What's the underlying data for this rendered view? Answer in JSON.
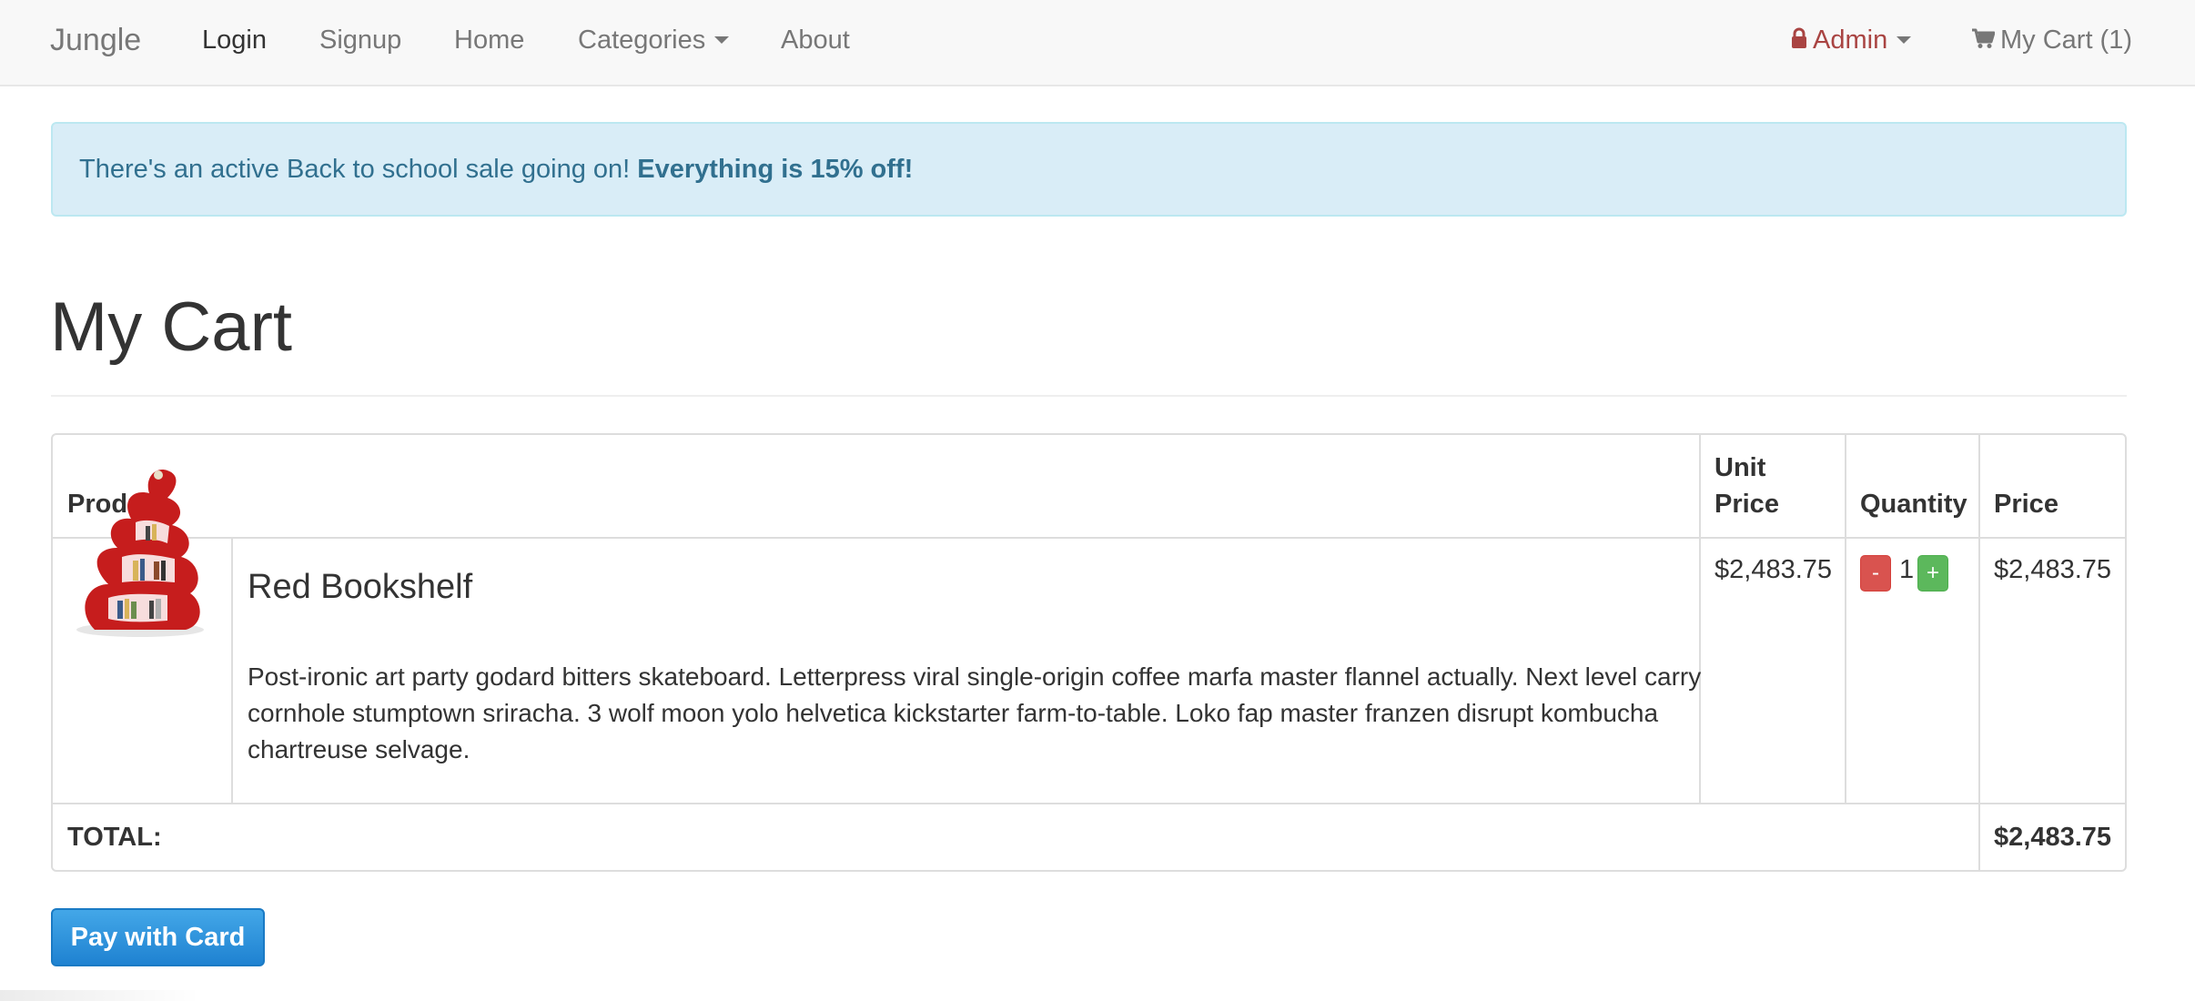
{
  "navbar": {
    "brand": "Jungle",
    "login": "Login",
    "signup": "Signup",
    "home": "Home",
    "categories": "Categories",
    "about": "About",
    "admin": "Admin",
    "cart": "My Cart (1)"
  },
  "alert": {
    "text": "There's an active Back to school sale going on! ",
    "emphasis": "Everything is 15% off!"
  },
  "page": {
    "title": "My Cart"
  },
  "table": {
    "headers": {
      "product": "Product",
      "unit_price_line1": "Unit",
      "unit_price_line2": "Price",
      "quantity": "Quantity",
      "price": "Price"
    },
    "rows": [
      {
        "name": "Red Bookshelf",
        "description": "Post-ironic art party godard bitters skateboard. Letterpress viral single-origin coffee marfa master flannel actually. Next level carry cornhole stumptown sriracha. 3 wolf moon yolo helvetica kickstarter farm-to-table. Loko fap master franzen disrupt kombucha chartreuse selvage.",
        "unit_price": "$2,483.75",
        "quantity": "1",
        "minus_label": "-",
        "plus_label": "+",
        "price": "$2,483.75",
        "image_icon": "bookshelf-image"
      }
    ],
    "total_label": "TOTAL:",
    "total_value": "$2,483.75"
  },
  "actions": {
    "pay_label": "Pay with Card"
  },
  "colors": {
    "navbar_bg": "#f8f8f8",
    "alert_bg": "#d9edf7",
    "alert_text": "#31708f",
    "admin_text": "#a94442",
    "minus_btn": "#d9534f",
    "plus_btn": "#5cb85c",
    "pay_btn": "#1f82d1"
  }
}
